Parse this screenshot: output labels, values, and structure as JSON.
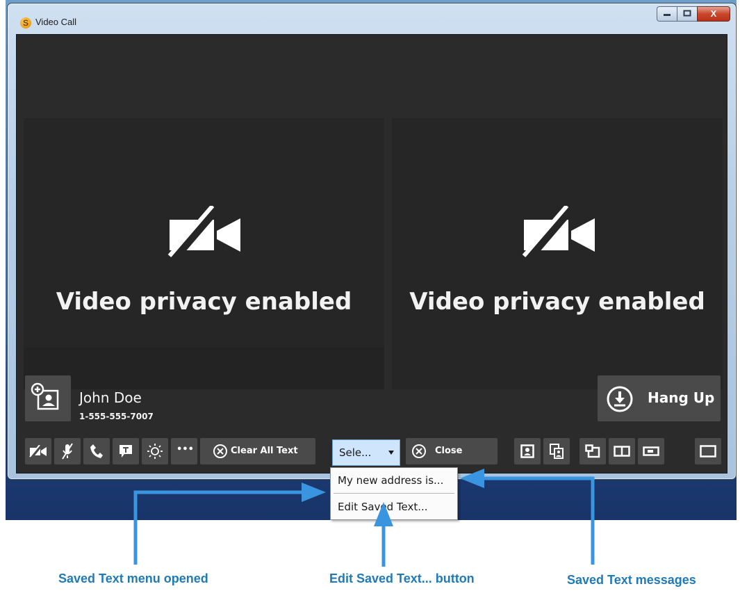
{
  "window": {
    "title": "Video Call",
    "app_icon_letter": "S"
  },
  "caption_buttons": {
    "minimize": "—",
    "maximize": "□",
    "close": "X"
  },
  "panels": {
    "left_message": "Video privacy enabled",
    "right_message": "Video privacy enabled"
  },
  "contact": {
    "name": "John Doe",
    "number": "1-555-555-7007"
  },
  "hangup": {
    "label": "Hang Up"
  },
  "toolbar": {
    "clear_all_text": "Clear All Text",
    "more_glyph": "•••",
    "select_value": "Sele...",
    "close_label": "Close"
  },
  "saved_text_menu": {
    "items": [
      "My new address is...",
      "Edit Saved Text..."
    ]
  },
  "annotations": {
    "menu_opened": "Saved Text menu opened",
    "edit_button": "Edit Saved Text... button",
    "messages": "Saved Text messages"
  },
  "colors": {
    "annotation": "#1f7ab8",
    "select_bg": "#cfe5fb",
    "button_bg": "#4a4a4a"
  }
}
